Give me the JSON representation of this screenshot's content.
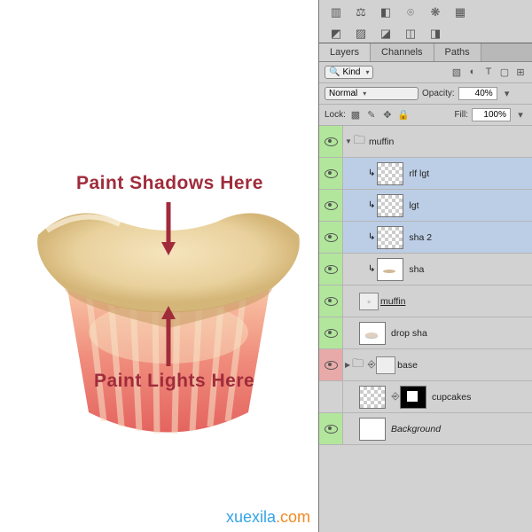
{
  "canvas": {
    "shadow_label": "Paint Shadows Here",
    "light_label": "Paint Lights Here",
    "watermark_a": "xuexila",
    "watermark_b": ".com"
  },
  "panel": {
    "tabs": [
      "Layers",
      "Channels",
      "Paths"
    ],
    "kind": "Kind",
    "blend": "Normal",
    "opacity_lbl": "Opacity:",
    "opacity": "40%",
    "lock_lbl": "Lock:",
    "fill_lbl": "Fill:",
    "fill": "100%"
  },
  "layers": [
    {
      "name": "muffin",
      "type": "group",
      "vis": true
    },
    {
      "name": "rlf lgt",
      "sel": true,
      "clip": true,
      "vis": true,
      "th": "chk"
    },
    {
      "name": "lgt",
      "sel": true,
      "clip": true,
      "vis": true,
      "th": "chk"
    },
    {
      "name": "sha 2",
      "sel": true,
      "clip": true,
      "vis": true,
      "th": "chk"
    },
    {
      "name": "sha",
      "clip": true,
      "vis": true,
      "th": "tiny"
    },
    {
      "name": "muffin",
      "u": true,
      "vis": true,
      "smart": true
    },
    {
      "name": "drop sha",
      "vis": true,
      "th": "drop"
    },
    {
      "name": "base",
      "type": "group2",
      "vis": true,
      "red": true
    },
    {
      "name": "cupcakes",
      "vis": false,
      "mask": true
    },
    {
      "name": "Background",
      "vis": true,
      "i": true,
      "th": "white"
    }
  ]
}
